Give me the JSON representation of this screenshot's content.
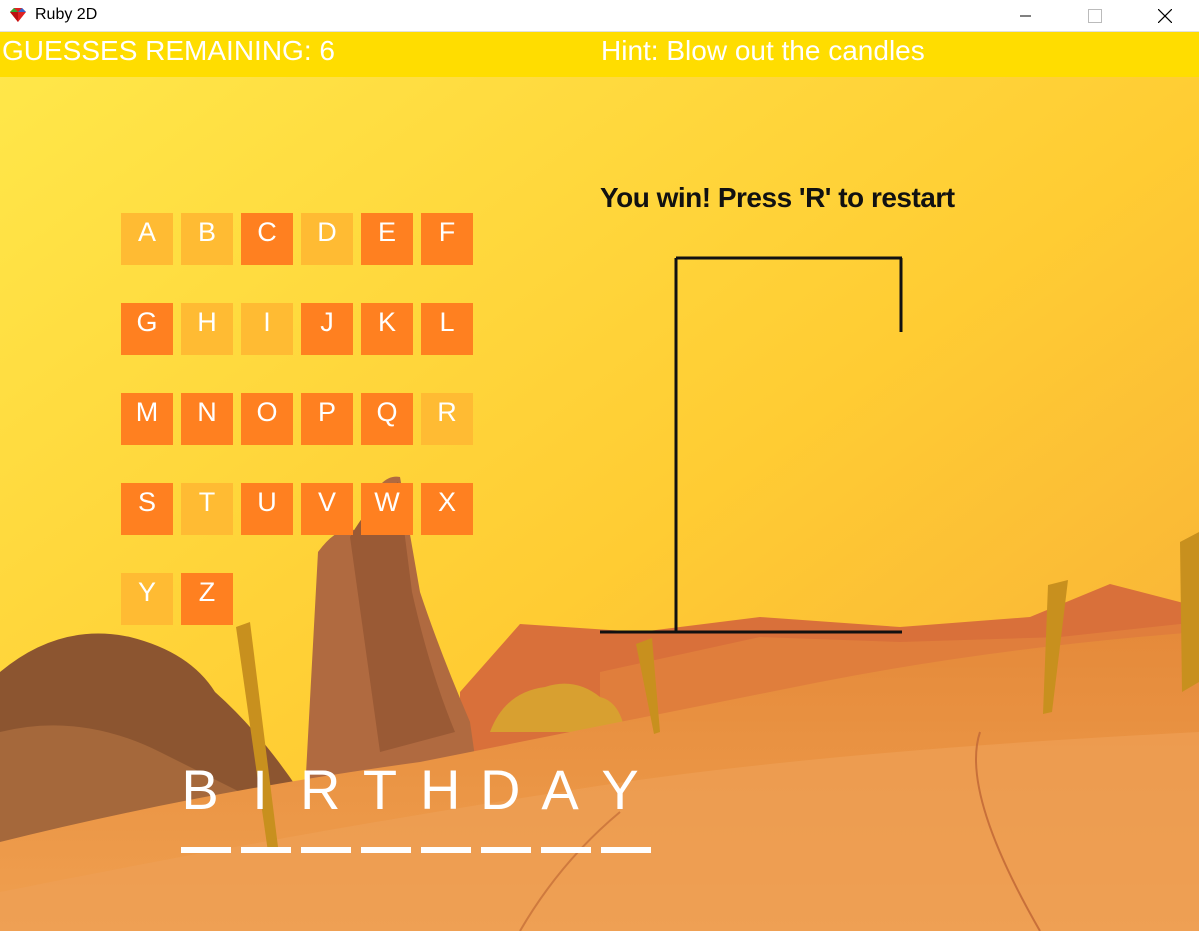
{
  "window": {
    "title": "Ruby 2D",
    "icon": "ruby2d-logo-icon",
    "controls": [
      "minimize-icon",
      "maximize-icon",
      "close-icon"
    ]
  },
  "hud": {
    "guesses_remaining": "GUESSES REMAINING: 6",
    "hint": "Hint: Blow out the candles"
  },
  "status_message": "You win! Press 'R' to restart",
  "letters": [
    {
      "letter": "A",
      "guessed": false
    },
    {
      "letter": "B",
      "guessed": false
    },
    {
      "letter": "C",
      "guessed": true
    },
    {
      "letter": "D",
      "guessed": false
    },
    {
      "letter": "E",
      "guessed": true
    },
    {
      "letter": "F",
      "guessed": true
    },
    {
      "letter": "G",
      "guessed": true
    },
    {
      "letter": "H",
      "guessed": false
    },
    {
      "letter": "I",
      "guessed": false
    },
    {
      "letter": "J",
      "guessed": true
    },
    {
      "letter": "K",
      "guessed": true
    },
    {
      "letter": "L",
      "guessed": true
    },
    {
      "letter": "M",
      "guessed": true
    },
    {
      "letter": "N",
      "guessed": true
    },
    {
      "letter": "O",
      "guessed": true
    },
    {
      "letter": "P",
      "guessed": true
    },
    {
      "letter": "Q",
      "guessed": true
    },
    {
      "letter": "R",
      "guessed": false
    },
    {
      "letter": "S",
      "guessed": true
    },
    {
      "letter": "T",
      "guessed": false
    },
    {
      "letter": "U",
      "guessed": true
    },
    {
      "letter": "V",
      "guessed": true
    },
    {
      "letter": "W",
      "guessed": true
    },
    {
      "letter": "X",
      "guessed": true
    },
    {
      "letter": "Y",
      "guessed": false
    },
    {
      "letter": "Z",
      "guessed": true
    }
  ],
  "word": [
    "B",
    "I",
    "R",
    "T",
    "H",
    "D",
    "A",
    "Y"
  ],
  "colors": {
    "hud_bar": "#ffdd00",
    "tile_guessed": "#ff8020",
    "tile_available": "#ffbb33",
    "text": "#ffffff"
  }
}
